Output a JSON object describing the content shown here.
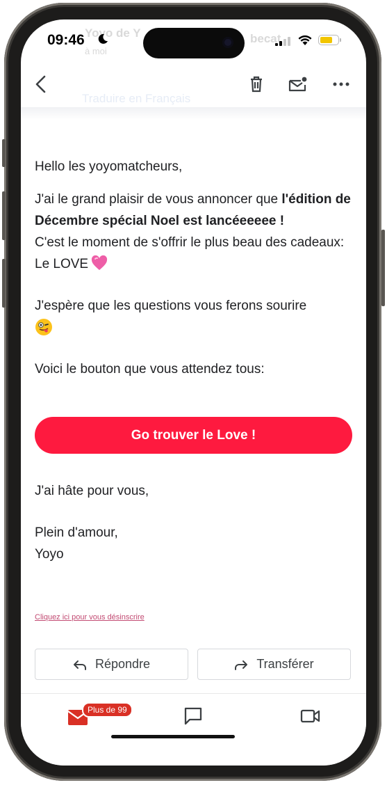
{
  "status_bar": {
    "time": "09:46"
  },
  "ghost_header": {
    "sender": "Yoyo de Y",
    "sub": "à moi",
    "extra": "becat"
  },
  "toolbar": {
    "back_icon": "chevron-left-icon",
    "delete_icon": "trash-icon",
    "mark_unread_icon": "mail-unread-icon",
    "more_icon": "more-horizontal-icon"
  },
  "translate_ghost": "Traduire en Français",
  "email": {
    "greeting": "Hello les yoyomatcheurs,",
    "line1": "J'ai le grand plaisir de vous annoncer que",
    "line1_bold": "l'édition de Décembre spécial Noel est lancéeeeee !",
    "line2": "C'est le moment de s'offrir le plus beau des cadeaux: Le LOVE",
    "line3": "J'espère que les questions vous ferons sourire",
    "line4": "Voici le bouton que vous attendez tous:",
    "cta_label": "Go trouver le Love !",
    "closing1": "J'ai hâte pour vous,",
    "closing2": "Plein d'amour,",
    "signature": "Yoyo",
    "unsubscribe": "Cliquez ici pour vous désinscrire"
  },
  "actions": {
    "reply_label": "Répondre",
    "forward_label": "Transférer"
  },
  "bottom_nav": {
    "mail_badge": "Plus de 99",
    "mail_icon": "mail-icon",
    "chat_icon": "chat-icon",
    "meet_icon": "video-icon"
  },
  "colors": {
    "cta": "#fe1a3f",
    "badge": "#d93025",
    "mail_icon": "#d93025"
  }
}
